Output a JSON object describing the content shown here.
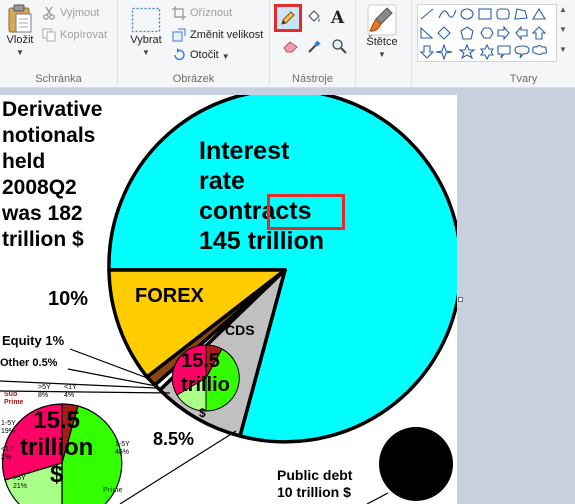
{
  "ribbon": {
    "clipboard": {
      "paste_label": "Vložit",
      "cut_label": "Vyjmout",
      "copy_label": "Kopírovat",
      "group_label": "Schránka"
    },
    "image": {
      "select_label": "Vybrat",
      "crop_label": "Oříznout",
      "resize_label": "Změnit velikost",
      "rotate_label": "Otočit",
      "group_label": "Obrázek"
    },
    "tools": {
      "group_label": "Nástroje",
      "text_tool_glyph": "A"
    },
    "brushes": {
      "label": "Štětce"
    },
    "shapes": {
      "group_label": "Tvary"
    }
  },
  "canvas": {
    "headline": "Derivative\nnotionals\nheld\n2008Q2\nwas 182\ntrillion $",
    "pct_forex_left": "10%",
    "interest_rate_text": "Interest\nrate\ncontracts\n145 trillion",
    "forex_label": "FOREX",
    "cds_label": "CDS",
    "small_pie_text": "15.5\ntrillio",
    "small_pie_symbol": "$",
    "equity_label": "Equity 1%",
    "other_label": "Other 0.5%",
    "pct_85": "8.5%",
    "detail_pie_text": "15.5\ntrillion\n$",
    "detail_labels": {
      "top_a": ">5Y\n8%",
      "top_b": "<1Y\n4%",
      "sub_prime": "Sub\nPrime",
      "left_1": "1-5Y\n19%",
      "left_2": "<1Y\n2%",
      "left_3": ">5Y\n21%",
      "right": "1-5Y\n46%",
      "prime": "Prime"
    },
    "public_debt": "Public debt\n10 trillion $"
  },
  "colors": {
    "interest": "#00ffff",
    "forex": "#ffcc00",
    "cds": "#c0c0c0",
    "equity": "#8b4513",
    "subprime": "#ff0066",
    "prime": "#33ff00",
    "highlight": "#e32d2d"
  }
}
